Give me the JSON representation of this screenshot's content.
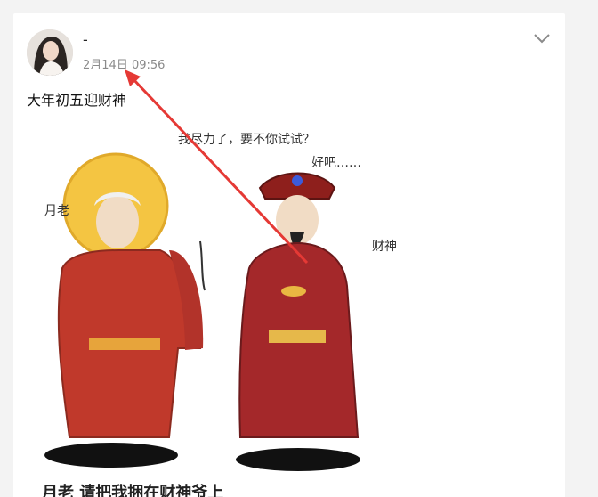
{
  "post": {
    "username": "-",
    "timestamp": "2月14日 09:56",
    "text": "大年初五迎财神",
    "caption": "月老 请把我捆在财神爷上"
  },
  "illustration": {
    "label_left": "月老",
    "label_right": "财神",
    "speech_left": "我尽力了，要不你试试？",
    "speech_right": "好吧……"
  },
  "icons": {
    "more": "chevron-down-icon",
    "avatar": "avatar"
  },
  "colors": {
    "robe_red": "#c0392b",
    "halo": "#f4c542",
    "annotation_arrow": "#e53935"
  }
}
